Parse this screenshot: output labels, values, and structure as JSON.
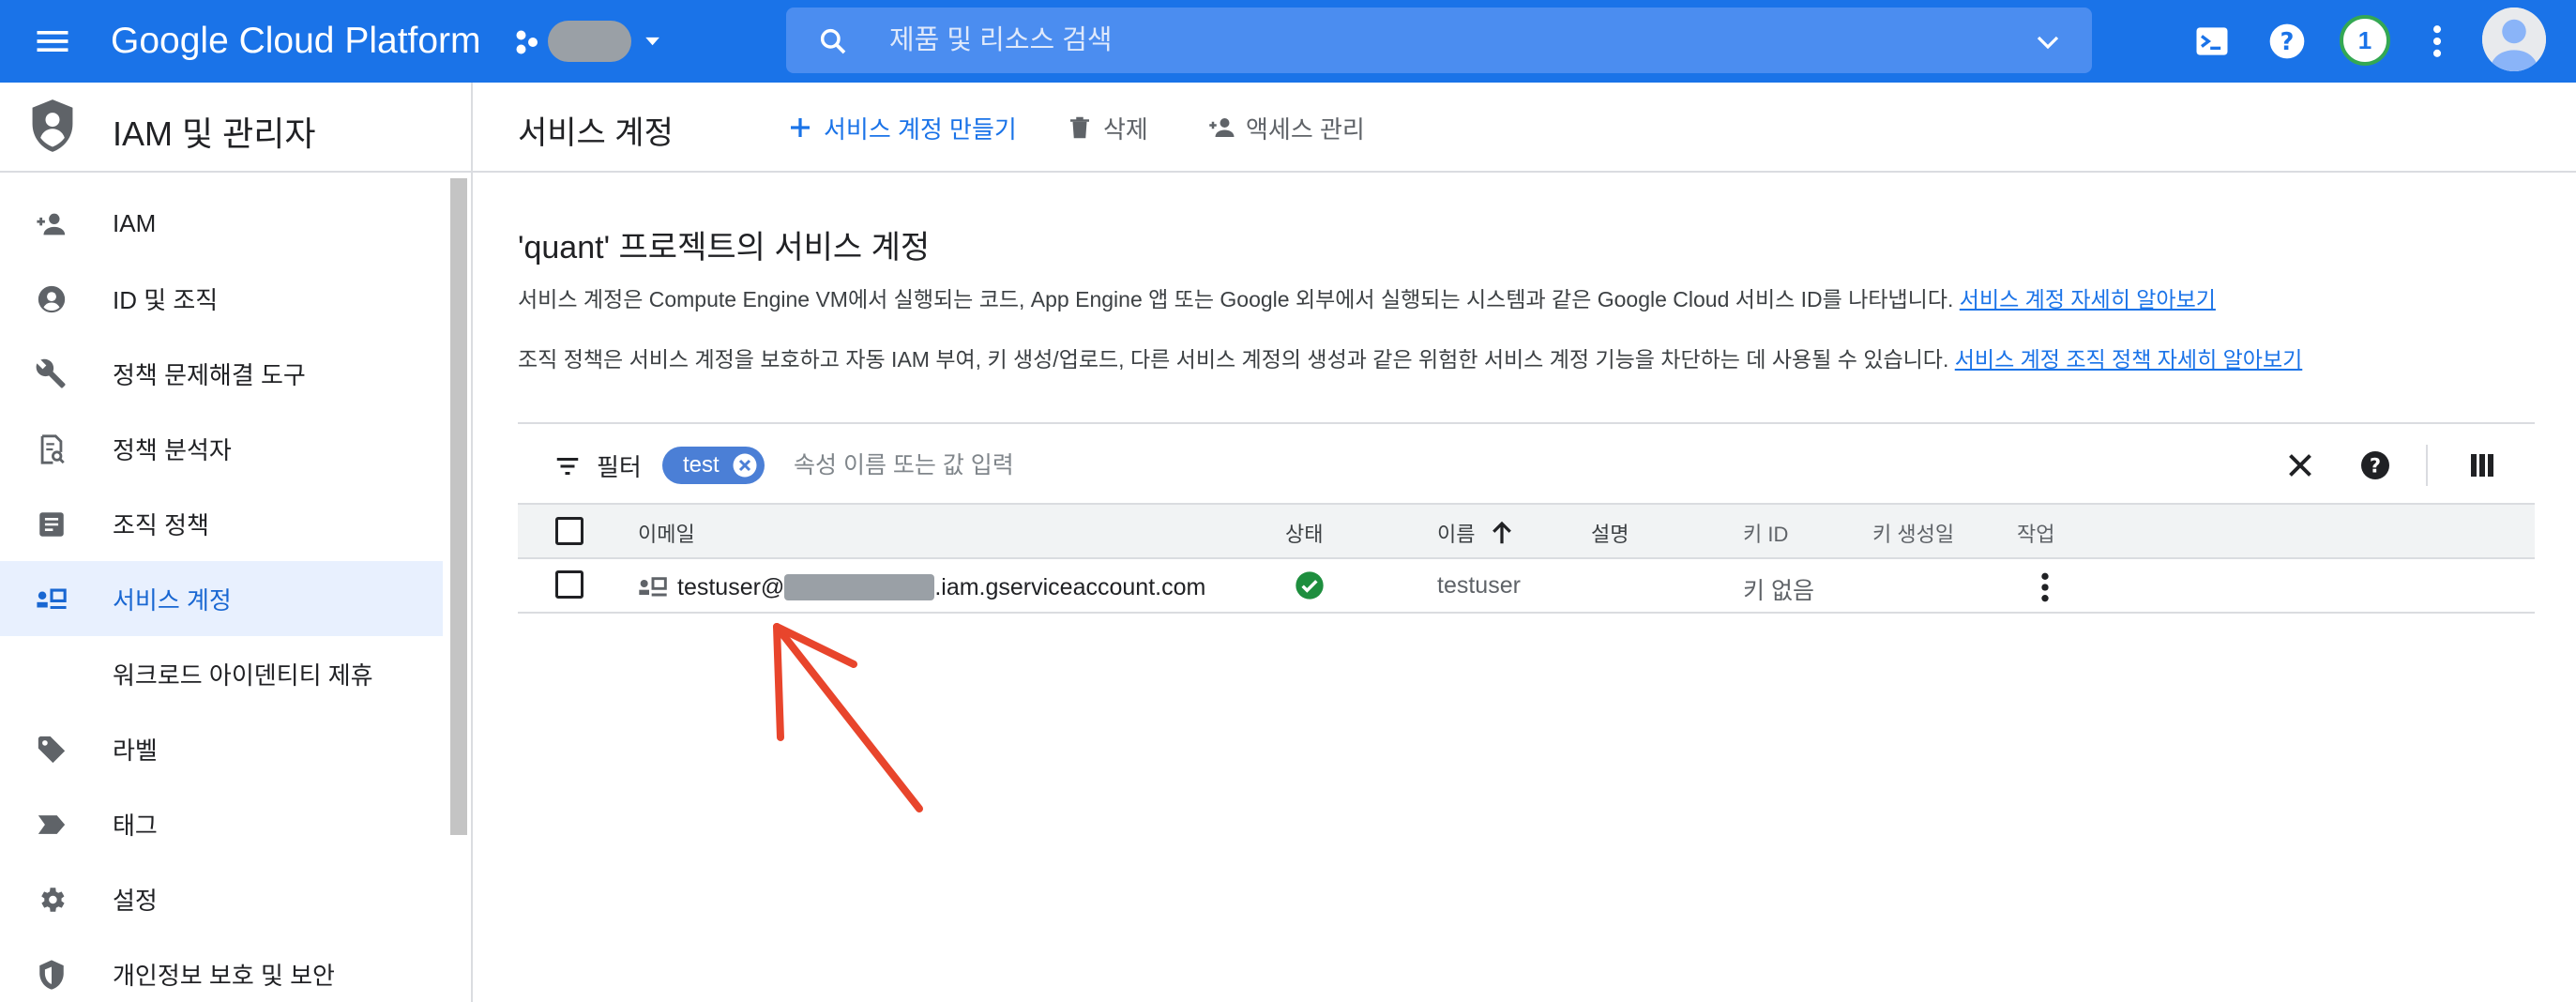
{
  "topbar": {
    "brand": "Google Cloud Platform",
    "search_placeholder": "제품 및 리소스 검색",
    "notification_count": "1",
    "colors": {
      "bar": "#1a73e8",
      "search": "#4b8df0"
    }
  },
  "leftnav": {
    "title": "IAM 및 관리자",
    "items": [
      {
        "label": "IAM",
        "icon": "person-add-icon"
      },
      {
        "label": "ID 및 조직",
        "icon": "account-circle-icon"
      },
      {
        "label": "정책 문제해결 도구",
        "icon": "wrench-icon"
      },
      {
        "label": "정책 분석자",
        "icon": "document-search-icon"
      },
      {
        "label": "조직 정책",
        "icon": "list-document-icon"
      },
      {
        "label": "서비스 계정",
        "icon": "service-account-icon",
        "active": true
      },
      {
        "label": "워크로드 아이덴티티 제휴",
        "icon": ""
      },
      {
        "label": "라벨",
        "icon": "tag-icon"
      },
      {
        "label": "태그",
        "icon": "chevron-tag-icon"
      },
      {
        "label": "설정",
        "icon": "gear-icon"
      },
      {
        "label": "개인정보 보호 및 보안",
        "icon": "shield-icon"
      }
    ]
  },
  "header": {
    "page_title": "서비스 계정",
    "create_label": "서비스 계정 만들기",
    "delete_label": "삭제",
    "access_label": "액세스 관리"
  },
  "content": {
    "section_title": "'quant' 프로젝트의 서비스 계정",
    "desc1": "서비스 계정은 Compute Engine VM에서 실행되는 코드, App Engine 앱 또는 Google 외부에서 실행되는 시스템과 같은 Google Cloud 서비스 ID를 나타냅니다.",
    "desc1_link": "서비스 계정 자세히 알아보기",
    "desc2": "조직 정책은 서비스 계정을 보호하고 자동 IAM 부여, 키 생성/업로드, 다른 서비스 계정의 생성과 같은 위험한 서비스 계정 기능을 차단하는 데 사용될 수 있습니다.",
    "desc2_link": "서비스 계정 조직 정책 자세히 알아보기"
  },
  "table": {
    "filter_label": "필터",
    "chip_label": "test",
    "filter_placeholder": "속성 이름 또는 값 입력",
    "columns": [
      "이메일",
      "상태",
      "이름",
      "설명",
      "키 ID",
      "키 생성일",
      "작업"
    ],
    "rows": [
      {
        "email_prefix": "testuser@",
        "email_suffix": ".iam.gserviceaccount.com",
        "status": "enabled",
        "name": "testuser",
        "description": "",
        "key_id": "키 없음",
        "key_created": ""
      }
    ]
  }
}
